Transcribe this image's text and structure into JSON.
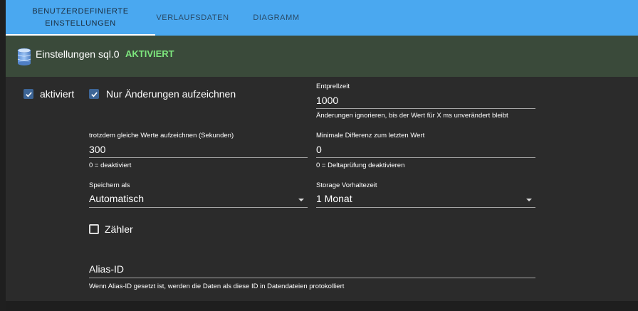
{
  "tabs": [
    {
      "label_line1": "BENUTZERDEFINIERTE",
      "label_line2": "EINSTELLUNGEN",
      "active": true
    },
    {
      "label": "VERLAUFSDATEN"
    },
    {
      "label": "DIAGRAMM"
    }
  ],
  "header": {
    "title": "Einstellungen sql.0",
    "status": "AKTIVIERT",
    "icon": "database-icon",
    "status_color": "#7de67d"
  },
  "form": {
    "enabled": {
      "label": "aktiviert",
      "checked": true
    },
    "changes_only": {
      "label": "Nur Änderungen aufzeichnen",
      "checked": true
    },
    "debounce": {
      "label": "Entprellzeit",
      "value": "1000",
      "help": "Änderungen ignorieren, bis der Wert für X ms unverändert bleibt"
    },
    "still_record": {
      "label": "trotzdem gleiche Werte aufzeichnen (Sekunden)",
      "value": "300",
      "help": "0 = deaktiviert"
    },
    "min_diff": {
      "label": "Minimale Differenz zum letzten Wert",
      "value": "0",
      "help": "0 = Deltaprüfung deaktivieren"
    },
    "store_as": {
      "label": "Speichern als",
      "value": "Automatisch"
    },
    "retention": {
      "label": "Storage Vorhaltezeit",
      "value": "1 Monat"
    },
    "counter": {
      "label": "Zähler",
      "checked": false
    },
    "alias": {
      "placeholder": "Alias-ID",
      "help": "Wenn Alias-ID gesetzt ist, werden die Daten als diese ID in Datendateien protokolliert"
    }
  },
  "colors": {
    "tabbar": "#4aa8f0",
    "header_bg": "#3a4a3a",
    "panel_bg": "#2b2b2b",
    "checkbox": "#3d6596"
  }
}
